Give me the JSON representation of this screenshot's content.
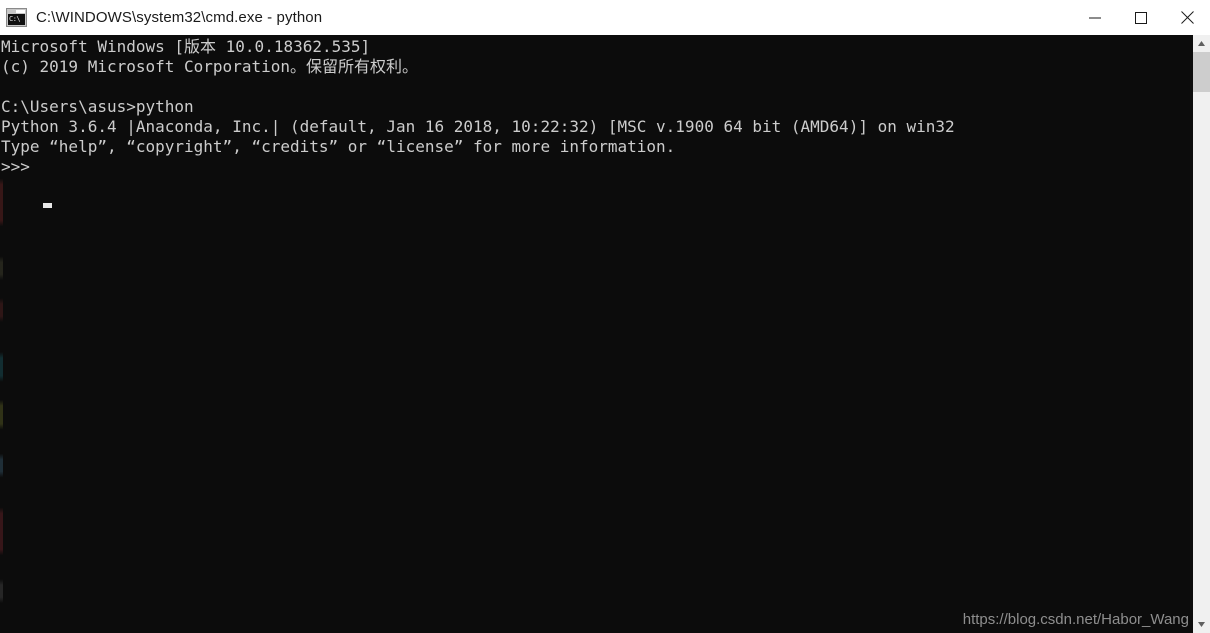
{
  "window": {
    "title": "C:\\WINDOWS\\system32\\cmd.exe - python",
    "icon_name": "cmd-console-icon",
    "icon_glyph": "C:\\",
    "controls": {
      "minimize_label": "Minimize",
      "maximize_label": "Maximize",
      "close_label": "Close"
    }
  },
  "console": {
    "background_color": "#0c0c0c",
    "foreground_color": "#cccccc",
    "lines": [
      "Microsoft Windows [版本 10.0.18362.535]",
      "(c) 2019 Microsoft Corporation。保留所有权利。",
      "",
      "C:\\Users\\asus>python",
      "Python 3.6.4 |Anaconda, Inc.| (default, Jan 16 2018, 10:22:32) [MSC v.1900 64 bit (AMD64)] on win32",
      "Type “help”, “copyright”, “credits” or “license” for more information.",
      ">>>"
    ],
    "text": "Microsoft Windows [版本 10.0.18362.535]\n(c) 2019 Microsoft Corporation。保留所有权利。\n\nC:\\Users\\asus>python\nPython 3.6.4 |Anaconda, Inc.| (default, Jan 16 2018, 10:22:32) [MSC v.1900 64 bit (AMD64)] on win32\nType “help”, “copyright”, “credits” or “license” for more information.\n>>>",
    "prompt": ">>>",
    "cursor_visible": true
  },
  "watermark": {
    "text": "https://blog.csdn.net/Habor_Wang"
  },
  "scrollbar": {
    "up_arrow": "▲",
    "down_arrow": "▼"
  }
}
